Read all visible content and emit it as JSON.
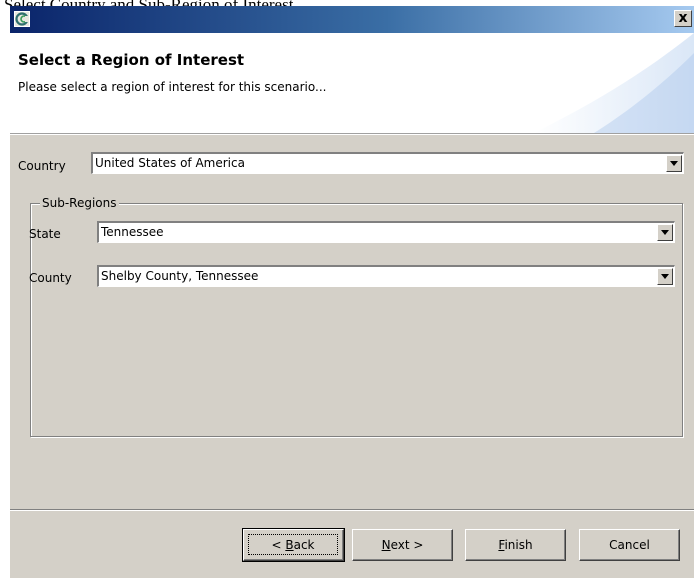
{
  "window": {
    "caption_text": "Select Country and Sub-Region of Interest",
    "app_icon": "app-logo-icon",
    "close_label": "x"
  },
  "header": {
    "title": "Select a Region of Interest",
    "description": "Please select a region of interest for this scenario..."
  },
  "form": {
    "country_label": "Country",
    "country_value": "United States of America",
    "subregions_legend": "Sub-Regions",
    "state_label": "State",
    "state_value": "Tennessee",
    "county_label": "County",
    "county_value": "Shelby County, Tennessee"
  },
  "buttons": {
    "back_pre": "< ",
    "back_mnemonic": "B",
    "back_post": "ack",
    "next_mnemonic": "N",
    "next_post": "ext >",
    "finish_mnemonic": "F",
    "finish_post": "inish",
    "cancel": "Cancel"
  },
  "colors": {
    "titlebar_start": "#0a246a",
    "titlebar_end": "#a6caf0",
    "dialog_face": "#d4d0c8"
  }
}
